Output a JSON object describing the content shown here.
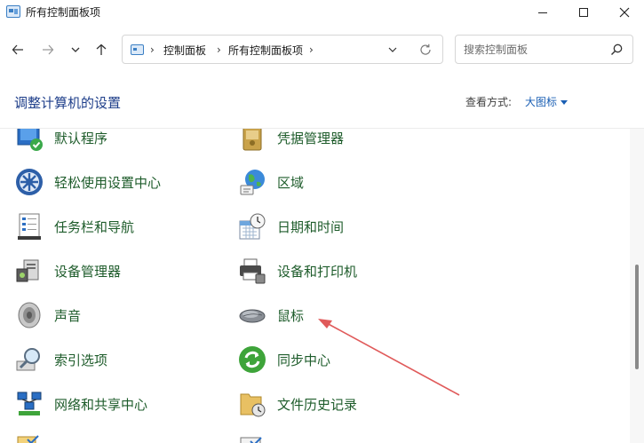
{
  "window": {
    "title": "所有控制面板项"
  },
  "nav": {
    "breadcrumbs": [
      "控制面板",
      "所有控制面板项"
    ],
    "search_placeholder": "搜索控制面板"
  },
  "header": {
    "title": "调整计算机的设置",
    "view_by_label": "查看方式:",
    "view_by_value": "大图标"
  },
  "items": [
    {
      "label": "默认程序",
      "icon": "default-programs-icon"
    },
    {
      "label": "凭据管理器",
      "icon": "credential-manager-icon"
    },
    {
      "label": "轻松使用设置中心",
      "icon": "ease-of-access-icon"
    },
    {
      "label": "区域",
      "icon": "region-globe-icon"
    },
    {
      "label": "任务栏和导航",
      "icon": "taskbar-icon"
    },
    {
      "label": "日期和时间",
      "icon": "date-time-icon"
    },
    {
      "label": "设备管理器",
      "icon": "device-manager-icon"
    },
    {
      "label": "设备和打印机",
      "icon": "printer-icon"
    },
    {
      "label": "声音",
      "icon": "speaker-icon"
    },
    {
      "label": "鼠标",
      "icon": "mouse-icon"
    },
    {
      "label": "索引选项",
      "icon": "indexing-icon"
    },
    {
      "label": "同步中心",
      "icon": "sync-center-icon"
    },
    {
      "label": "网络和共享中心",
      "icon": "network-icon"
    },
    {
      "label": "文件历史记录",
      "icon": "file-history-icon"
    }
  ],
  "colors": {
    "item_text": "#1e5c2b",
    "title_text": "#1e3e8a",
    "link_blue": "#1a5fb4",
    "annotation_arrow": "#e05a5a"
  }
}
